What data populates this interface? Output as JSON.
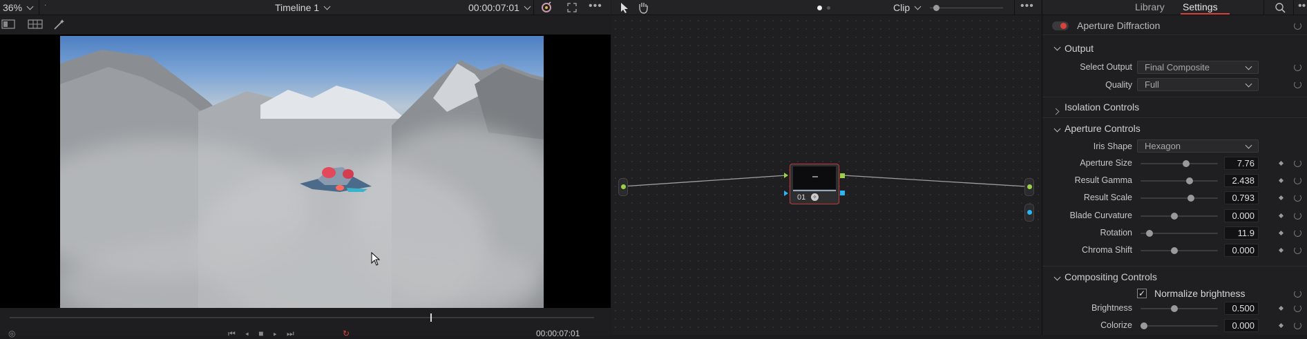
{
  "viewer": {
    "zoom": "36%",
    "timeline": "Timeline 1",
    "timecode": "00:00:07:01",
    "bottom_timecode": "00:00:07:01",
    "playhead_fraction": 0.72
  },
  "nodes": {
    "clip_label": "Clip",
    "node_label": "01"
  },
  "settings": {
    "tabs": [
      "Library",
      "Settings"
    ],
    "active_tab": "Settings",
    "effect_name": "Aperture Diffraction",
    "sections": {
      "output": "Output",
      "isolation": "Isolation Controls",
      "aperture": "Aperture Controls",
      "compositing": "Compositing Controls"
    },
    "select_output_label": "Select Output",
    "select_output_value": "Final Composite",
    "quality_label": "Quality",
    "quality_value": "Full",
    "iris_shape_label": "Iris Shape",
    "iris_shape_value": "Hexagon",
    "params": [
      {
        "label": "Aperture Size",
        "value": "7.76",
        "level": 0.6
      },
      {
        "label": "Result Gamma",
        "value": "2.438",
        "level": 0.65
      },
      {
        "label": "Result Scale",
        "value": "0.793",
        "level": 0.67
      },
      {
        "label": "Blade Curvature",
        "value": "0.000",
        "level": 0.43
      },
      {
        "label": "Rotation",
        "value": "11.9",
        "level": 0.08
      },
      {
        "label": "Chroma Shift",
        "value": "0.000",
        "level": 0.43
      }
    ],
    "normalize_label": "Normalize brightness",
    "normalize_checked": "✓",
    "comp_params": [
      {
        "label": "Brightness",
        "value": "0.500",
        "level": 0.43
      },
      {
        "label": "Colorize",
        "value": "0.000",
        "level": 0.0
      }
    ]
  },
  "colors": {
    "accent": "#d9413b",
    "node_input": "#8bc34a",
    "node_output": "#29b6f6"
  }
}
